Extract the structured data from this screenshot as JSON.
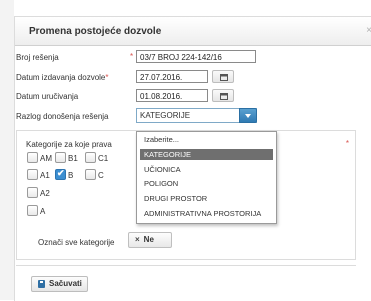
{
  "dialog": {
    "title": "Promena postojeće dozvole",
    "close_glyph": "×"
  },
  "form": {
    "broj_resenja": {
      "label": "Broj rešenja",
      "required": "*",
      "value": "03/7 BROJ 224-142/16"
    },
    "datum_izdavanja": {
      "label": "Datum izdavanja dozvole",
      "required": "*",
      "value": "27.07.2016."
    },
    "datum_urucivanja": {
      "label": "Datum uručivanja",
      "value": "01.08.2016."
    },
    "razlog": {
      "label": "Razlog donošenja rešenja",
      "value": "KATEGORIJE"
    }
  },
  "kategorije": {
    "label": "Kategorije za koje prava",
    "required": "*",
    "checkboxes": [
      {
        "label": "AM",
        "checked": false
      },
      {
        "label": "B1",
        "checked": false
      },
      {
        "label": "C1",
        "checked": false
      },
      {
        "label": "A1",
        "checked": false
      },
      {
        "label": "B",
        "checked": true
      },
      {
        "label": "C",
        "checked": false
      },
      {
        "label": "A2",
        "checked": false
      },
      {
        "label": "A",
        "checked": false
      }
    ],
    "select_all_label": "Označi sve kategorije",
    "select_all_button": {
      "icon": "close-icon",
      "glyph": "×",
      "label": "Ne"
    }
  },
  "dropdown": {
    "options": [
      "Izaberite...",
      "KATEGORIJE",
      "UČIONICA",
      "POLIGON",
      "DRUGI PROSTOR",
      "ADMINISTRATIVNA PROSTORIJA"
    ],
    "selected": "KATEGORIJE"
  },
  "footer": {
    "save_label": "Sačuvati",
    "save_icon": "floppy-icon"
  },
  "colors": {
    "required": "#d9534f",
    "select_accent": "#2f7ab3",
    "checkbox_checked": "#3b8ed1",
    "dropdown_selected_bg": "#6f6f6f"
  }
}
